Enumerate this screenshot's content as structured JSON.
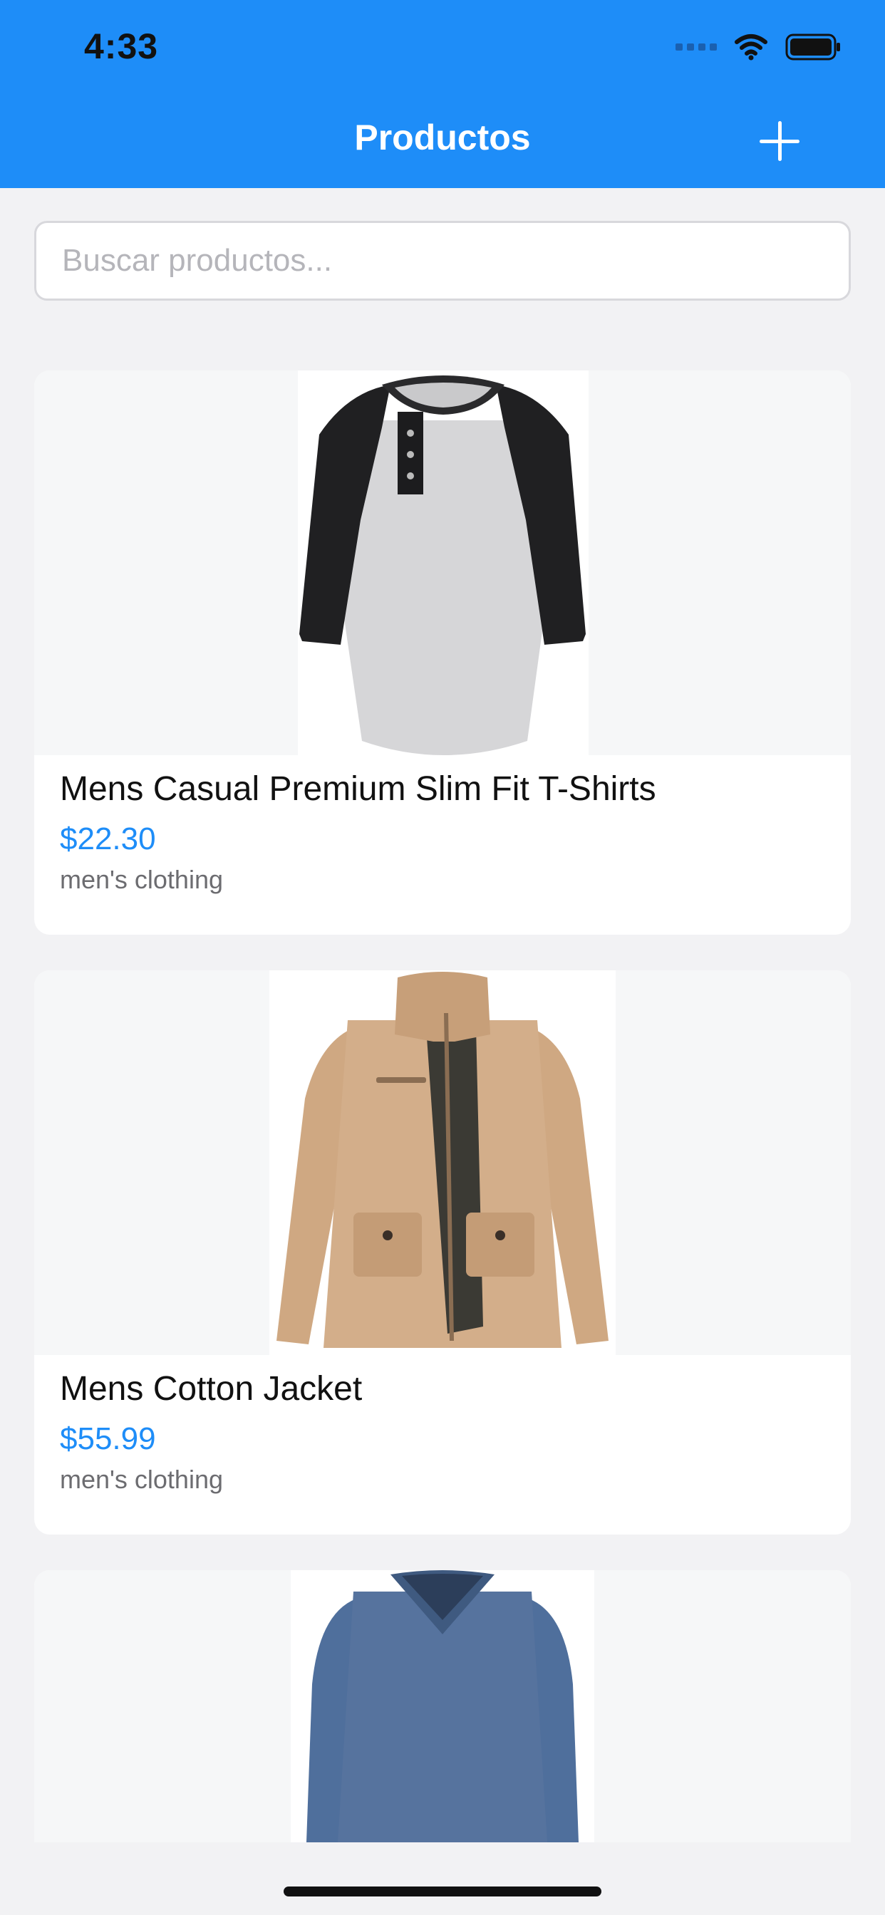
{
  "status_bar": {
    "time": "4:33"
  },
  "nav": {
    "title": "Productos",
    "add_icon": "plus-icon"
  },
  "search": {
    "placeholder": "Buscar productos...",
    "value": ""
  },
  "products": [
    {
      "title": "Mens Casual Premium Slim Fit T-Shirts",
      "price": "$22.30",
      "category": "men's clothing"
    },
    {
      "title": "Mens Cotton Jacket",
      "price": "$55.99",
      "category": "men's clothing"
    },
    {
      "title": "",
      "price": "",
      "category": ""
    }
  ],
  "colors": {
    "primary": "#1e8df8",
    "background": "#f2f2f4",
    "card": "#ffffff",
    "muted_text": "#6c6c70"
  }
}
